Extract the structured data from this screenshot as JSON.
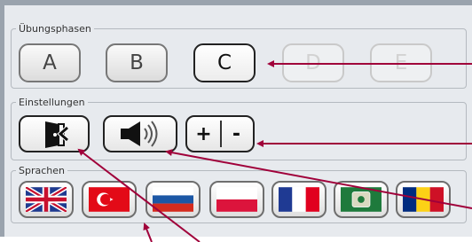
{
  "groups": {
    "phases": "Übungsphasen",
    "settings": "Einstellungen",
    "languages": "Sprachen"
  },
  "phase_buttons": [
    {
      "label": "A",
      "state": "enabled"
    },
    {
      "label": "B",
      "state": "enabled"
    },
    {
      "label": "C",
      "state": "selected"
    },
    {
      "label": "D",
      "state": "disabled"
    },
    {
      "label": "E",
      "state": "disabled"
    }
  ],
  "settings": {
    "exit_icon": "exit-door-icon",
    "sound_icon": "speaker-sound-icon",
    "plus_label": "+",
    "minus_label": "-"
  },
  "languages": [
    {
      "name": "uk-flag-icon"
    },
    {
      "name": "turkey-flag-icon"
    },
    {
      "name": "russia-flag-icon"
    },
    {
      "name": "poland-flag-icon"
    },
    {
      "name": "france-flag-icon"
    },
    {
      "name": "arab-flag-icon"
    },
    {
      "name": "romania-flag-icon"
    }
  ],
  "colors": {
    "panel_bg": "#e7eaee",
    "annotation_arrow": "#a0003a"
  }
}
